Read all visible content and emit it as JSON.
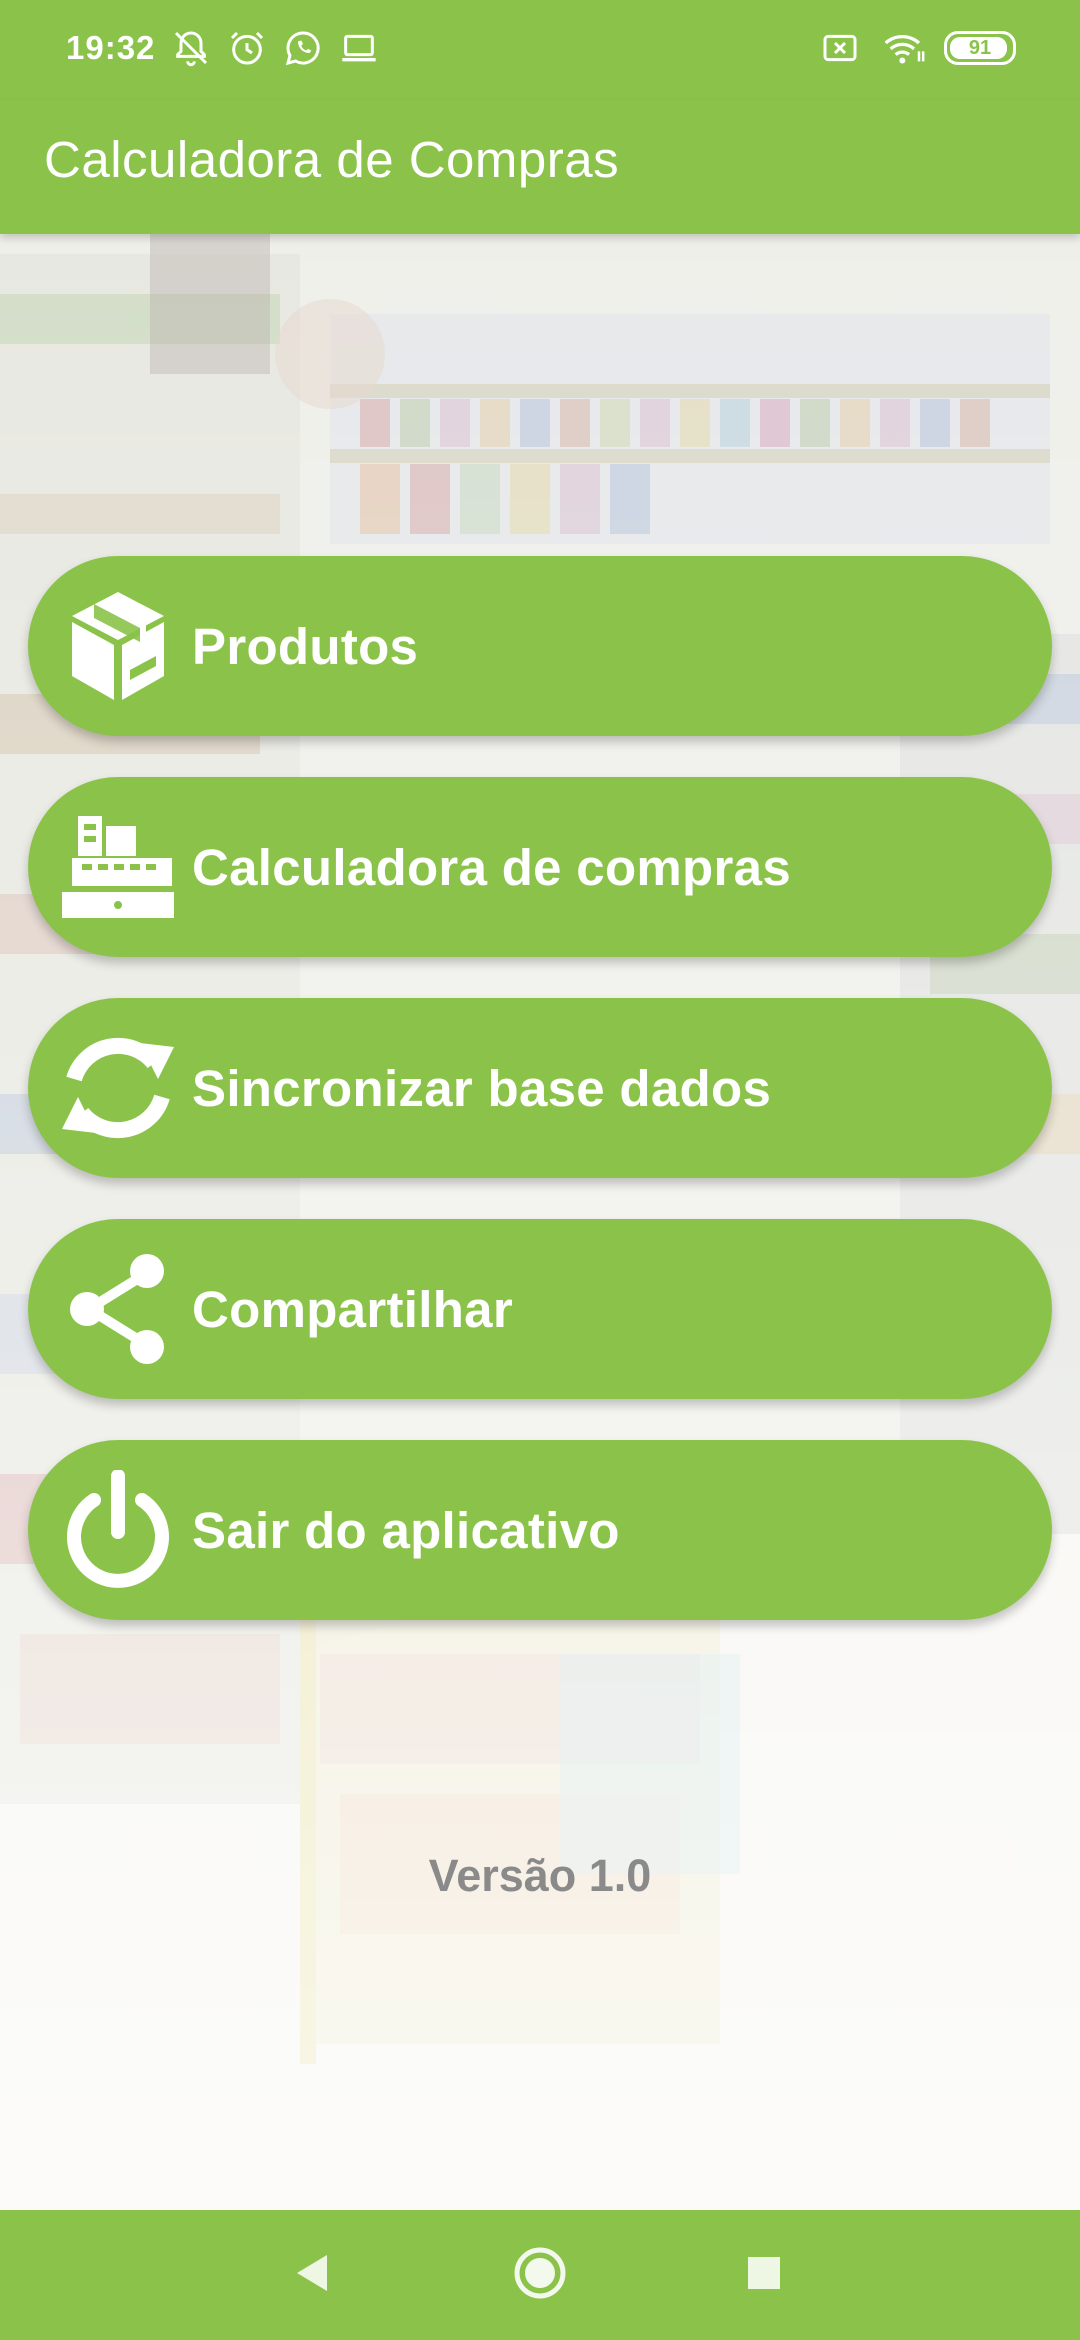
{
  "status_bar": {
    "time": "19:32",
    "battery_level": "91",
    "icons_left": [
      "notifications-muted-icon",
      "alarm-icon",
      "whatsapp-icon",
      "laptop-icon"
    ],
    "icons_right": [
      "no-sim-icon",
      "wifi-icon",
      "battery-icon"
    ]
  },
  "app_bar": {
    "title": "Calculadora de Compras"
  },
  "menu": {
    "items": [
      {
        "label": "Produtos",
        "icon": "box-icon"
      },
      {
        "label": "Calculadora de compras",
        "icon": "cash-register-icon"
      },
      {
        "label": "Sincronizar base dados",
        "icon": "sync-icon"
      },
      {
        "label": "Compartilhar",
        "icon": "share-icon"
      },
      {
        "label": "Sair do aplicativo",
        "icon": "power-icon"
      }
    ]
  },
  "footer": {
    "version": "Versão 1.0"
  },
  "colors": {
    "primary": "#8bc34a",
    "on_primary": "#ffffff",
    "version_text": "#8a8a8a"
  },
  "nav_bar": {
    "buttons": [
      "back-icon",
      "home-icon",
      "recents-icon"
    ]
  }
}
